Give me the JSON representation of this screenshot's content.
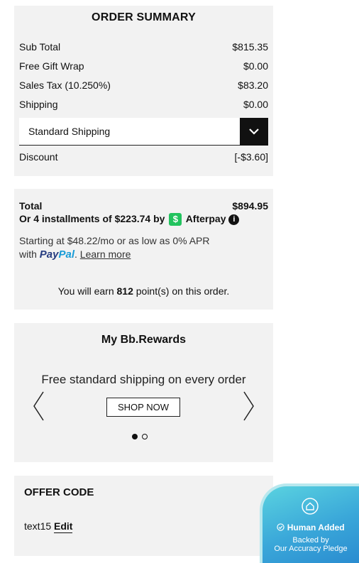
{
  "summary": {
    "title": "ORDER SUMMARY",
    "rows": [
      {
        "label": "Sub Total",
        "value": "$815.35"
      },
      {
        "label": "Free Gift Wrap",
        "value": "$0.00"
      },
      {
        "label": "Sales Tax (10.250%)",
        "value": "$83.20"
      },
      {
        "label": "Shipping",
        "value": "$0.00"
      }
    ],
    "shipping_option": "Standard Shipping",
    "discount": {
      "label": "Discount",
      "value": "[-$3.60]"
    }
  },
  "total": {
    "label": "Total",
    "value": "$894.95",
    "installments_prefix": "Or 4 installments of $223.74 by",
    "afterpay_icon": "$",
    "afterpay_label": "Afterpay",
    "info_icon": "i",
    "paypal_line1": "Starting at $48.22/mo or as low as 0% APR",
    "paypal_with": "with",
    "paypal_logo_pay": "Pay",
    "paypal_logo_pal": "Pal",
    "learn_more": "Learn more",
    "earn_prefix": "You will earn",
    "earn_points": "812",
    "earn_suffix": "point(s) on this order."
  },
  "rewards": {
    "title": "My Bb.Rewards",
    "message": "Free standard shipping on every order",
    "button": "SHOP NOW",
    "slides": 2,
    "active_slide": 1
  },
  "offer": {
    "title": "OFFER CODE",
    "code": "text15",
    "edit": "Edit"
  },
  "badge": {
    "line1": "Human Added",
    "line2": "Backed by",
    "line3": "Our Accuracy Pledge"
  },
  "colors": {
    "panel": "#f2f2f2",
    "afterpay": "#22c35e",
    "paypal_dark": "#253b80",
    "paypal_light": "#179bd7",
    "badge": "#3aa7d9"
  }
}
